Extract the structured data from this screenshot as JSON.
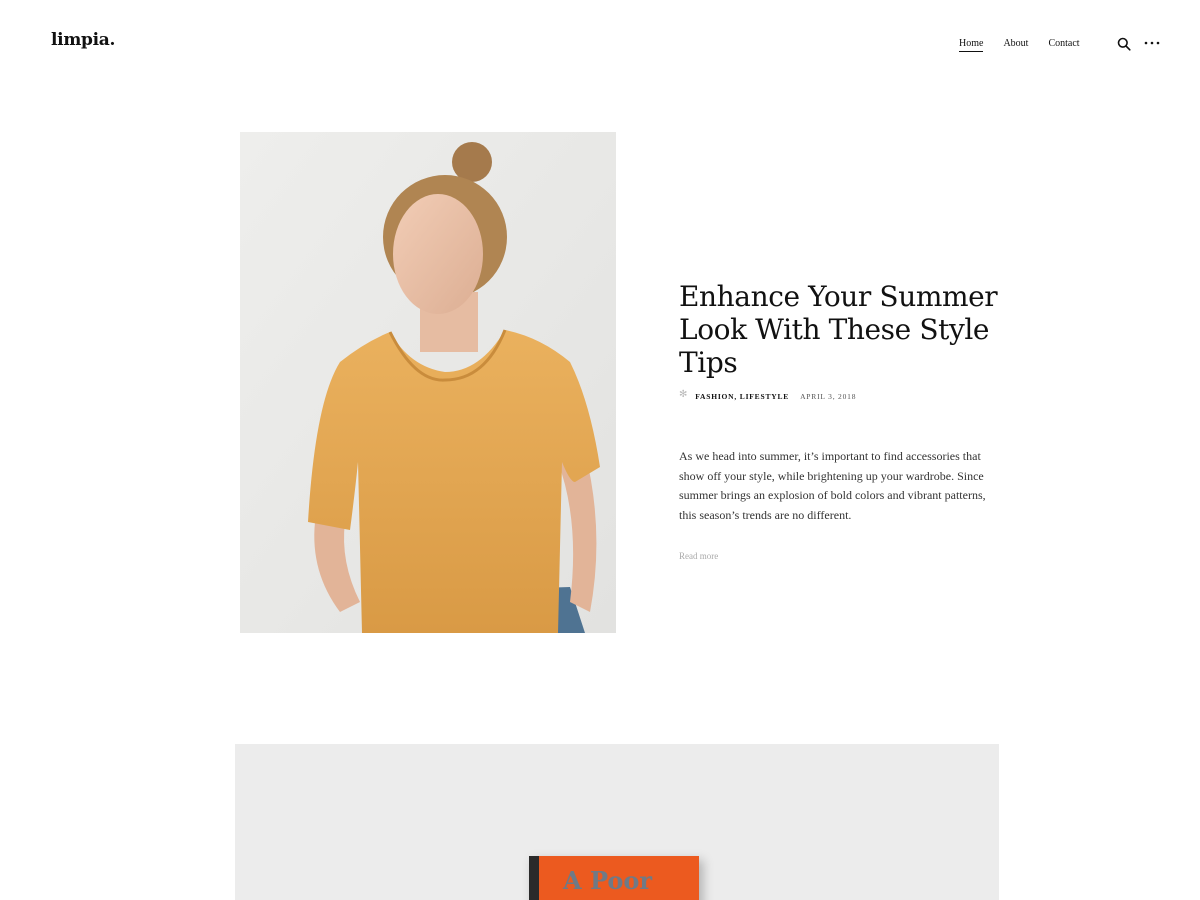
{
  "site": {
    "logo": "limpia."
  },
  "nav": {
    "items": [
      {
        "label": "Home",
        "active": true
      },
      {
        "label": "About",
        "active": false
      },
      {
        "label": "Contact",
        "active": false
      }
    ],
    "search_icon": "search-icon",
    "more_icon": "ellipsis-icon"
  },
  "featured_post": {
    "title": "Enhance Your Summer Look With These Style Tips",
    "categories": [
      "Fashion",
      "Lifestyle"
    ],
    "category_separator": ",",
    "date": "April 3, 2018",
    "excerpt": "As we head into summer, it’s important to find accessories that show off your style, while brightening up your wardrobe. Since summer brings an explosion of bold colors and vibrant patterns, this season’s trends are no different.",
    "read_more": "Read more"
  },
  "second_post": {
    "book_cover_text": "A Poor"
  },
  "colors": {
    "accent_shirt": "#e8aa55",
    "book_orange": "#ec5a1f",
    "muted_text": "#aaaaaa"
  }
}
